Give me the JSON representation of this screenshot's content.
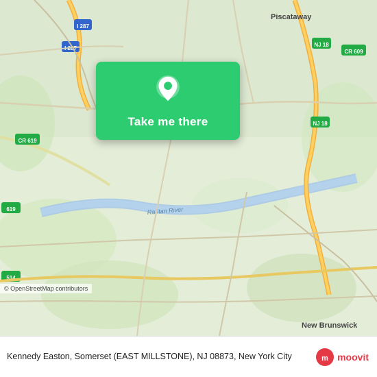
{
  "map": {
    "alt": "Map of Kennedy Easton area, New Jersey",
    "attribution": "© OpenStreetMap contributors"
  },
  "button": {
    "label": "Take me there"
  },
  "bottom_bar": {
    "address": "Kennedy Easton, Somerset (EAST MILLSTONE), NJ 08873, New York City"
  },
  "moovit": {
    "label": "moovit"
  },
  "icons": {
    "location_pin": "location-pin-icon",
    "moovit_logo": "moovit-logo-icon"
  }
}
